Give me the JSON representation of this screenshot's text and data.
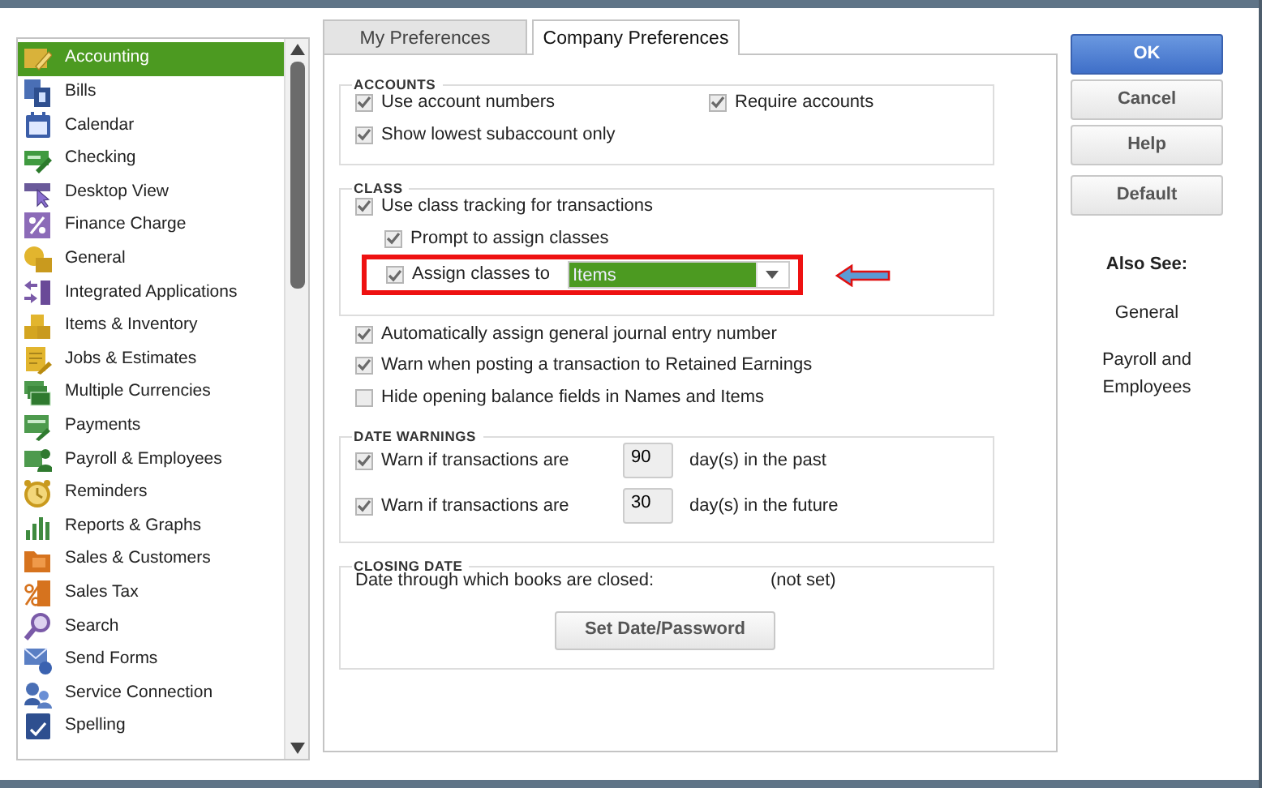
{
  "tabs": [
    {
      "label": "My Preferences",
      "selected": false
    },
    {
      "label": "Company Preferences",
      "selected": true
    }
  ],
  "sidebar": {
    "items": [
      {
        "label": "Accounting",
        "selected": true
      },
      {
        "label": "Bills",
        "selected": false
      },
      {
        "label": "Calendar",
        "selected": false
      },
      {
        "label": "Checking",
        "selected": false
      },
      {
        "label": "Desktop View",
        "selected": false
      },
      {
        "label": "Finance Charge",
        "selected": false
      },
      {
        "label": "General",
        "selected": false
      },
      {
        "label": "Integrated Applications",
        "selected": false
      },
      {
        "label": "Items & Inventory",
        "selected": false
      },
      {
        "label": "Jobs & Estimates",
        "selected": false
      },
      {
        "label": "Multiple Currencies",
        "selected": false
      },
      {
        "label": "Payments",
        "selected": false
      },
      {
        "label": "Payroll & Employees",
        "selected": false
      },
      {
        "label": "Reminders",
        "selected": false
      },
      {
        "label": "Reports & Graphs",
        "selected": false
      },
      {
        "label": "Sales & Customers",
        "selected": false
      },
      {
        "label": "Sales Tax",
        "selected": false
      },
      {
        "label": "Search",
        "selected": false
      },
      {
        "label": "Send Forms",
        "selected": false
      },
      {
        "label": "Service Connection",
        "selected": false
      },
      {
        "label": "Spelling",
        "selected": false
      }
    ]
  },
  "accounts": {
    "title": "ACCOUNTS",
    "options": [
      {
        "label": "Use account numbers",
        "checked": true
      },
      {
        "label": "Require accounts",
        "checked": true
      },
      {
        "label": "Show lowest subaccount only",
        "checked": true
      }
    ]
  },
  "class": {
    "title": "CLASS",
    "options": [
      {
        "label": "Use class tracking for transactions",
        "checked": true,
        "children": [
          {
            "label": "Prompt to assign classes",
            "checked": true
          },
          {
            "label": "Assign classes to",
            "checked": true,
            "highlighted": true,
            "dropdown": {
              "value": "Items"
            }
          }
        ]
      }
    ]
  },
  "general_options": [
    {
      "label": "Automatically assign general journal entry number",
      "checked": true
    },
    {
      "label": "Warn when posting a transaction to Retained Earnings",
      "checked": true
    },
    {
      "label": "Hide opening balance fields in Names and Items",
      "checked": false
    }
  ],
  "date_warnings": {
    "title": "DATE WARNINGS",
    "rows": [
      {
        "label": "Warn if transactions are",
        "checked": true,
        "days": "90",
        "suffix": "day(s) in the past"
      },
      {
        "label": "Warn if transactions are",
        "checked": true,
        "days": "30",
        "suffix": "day(s) in the future"
      }
    ]
  },
  "closing_date": {
    "title": "CLOSING DATE",
    "label": "Date through which books are closed:",
    "value": "(not set)",
    "button": "Set Date/Password"
  },
  "buttons": [
    {
      "label": "OK",
      "kind": "primary"
    },
    {
      "label": "Cancel",
      "kind": "secondary"
    },
    {
      "label": "Help",
      "kind": "secondary"
    },
    {
      "label": "Default",
      "kind": "secondary"
    }
  ],
  "also_see": {
    "title": "Also See:",
    "links": [
      "General",
      "Payroll and Employees"
    ]
  }
}
